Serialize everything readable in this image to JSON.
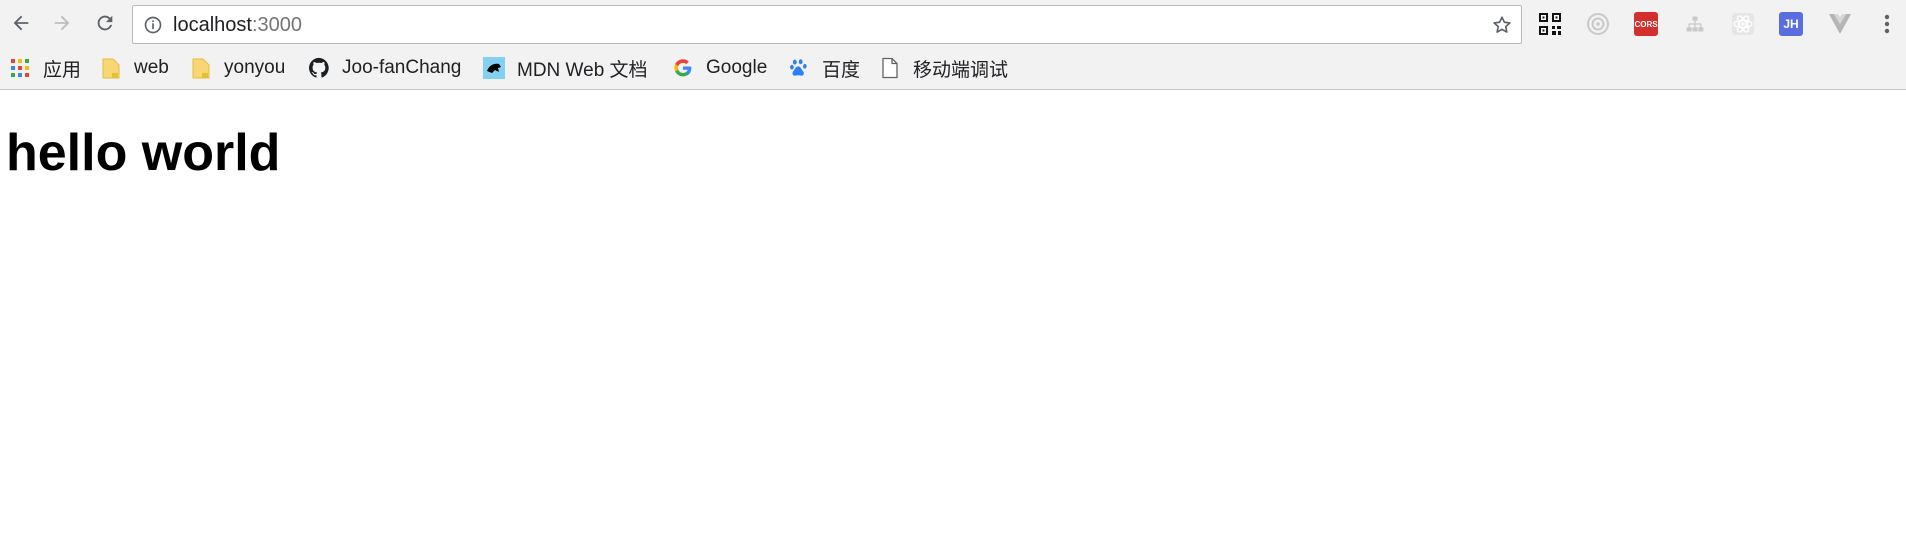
{
  "browser": {
    "address_bar": {
      "host": "localhost",
      "port": ":3000"
    },
    "bookmarks": [
      {
        "label": "应用",
        "icon": "apps-grid-icon"
      },
      {
        "label": "web",
        "icon": "folder-icon"
      },
      {
        "label": "yonyou",
        "icon": "folder-icon"
      },
      {
        "label": "Joo-fanChang",
        "icon": "github-icon"
      },
      {
        "label": "MDN Web 文档",
        "icon": "mdn-icon"
      },
      {
        "label": "Google",
        "icon": "google-icon"
      },
      {
        "label": "百度",
        "icon": "baidu-paw-icon"
      },
      {
        "label": "移动端调试",
        "icon": "page-icon"
      }
    ],
    "extensions": [
      {
        "name": "qr-code-icon"
      },
      {
        "name": "target-icon"
      },
      {
        "name": "cors-icon",
        "text": "CORS"
      },
      {
        "name": "sitemap-icon"
      },
      {
        "name": "react-devtools-icon"
      },
      {
        "name": "json-handle-icon",
        "text": "JH"
      },
      {
        "name": "vue-devtools-icon"
      },
      {
        "name": "menu-dots-icon"
      }
    ]
  },
  "page": {
    "heading": "hello world"
  },
  "colors": {
    "toolbar_bg": "#f2f2f2",
    "cors_red": "#d32f2f",
    "jh_blue": "#5b6ee1",
    "folder_yellow": "#f7d774"
  }
}
